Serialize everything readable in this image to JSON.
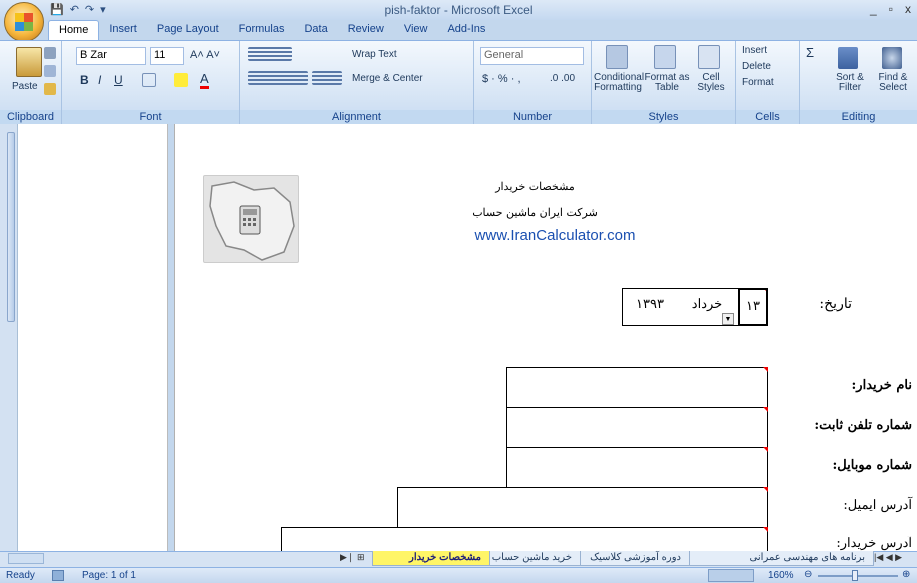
{
  "window": {
    "title": "pish-faktor - Microsoft Excel",
    "controls": [
      "_",
      "▫",
      "x"
    ]
  },
  "quick_access": {
    "save": "💾",
    "undo": "↶",
    "redo": "↷",
    "customize": "▾"
  },
  "ribbon_tabs": [
    "Home",
    "Insert",
    "Page Layout",
    "Formulas",
    "Data",
    "Review",
    "View",
    "Add-Ins"
  ],
  "ribbon": {
    "clipboard": {
      "label": "Clipboard",
      "paste": "Paste"
    },
    "font": {
      "label": "Font",
      "name": "B Zar",
      "size": "11"
    },
    "alignment": {
      "label": "Alignment",
      "wrap": "Wrap Text",
      "merge": "Merge & Center"
    },
    "number": {
      "label": "Number",
      "format": "General"
    },
    "styles": {
      "label": "Styles",
      "conditional": "Conditional Formatting",
      "format_table": "Format as Table",
      "cell_styles": "Cell Styles"
    },
    "cells": {
      "label": "Cells",
      "insert": "Insert",
      "delete": "Delete",
      "format": "Format"
    },
    "editing": {
      "label": "Editing",
      "sort": "Sort & Filter",
      "find": "Find & Select"
    }
  },
  "document": {
    "logo_text": "IRAN CALCULATOR",
    "buyer_header": "مشخصات خريدار",
    "company": "شرکت ایران ماشین حساب",
    "website": "www.IranCalculator.com",
    "date_label": "تاریخ:",
    "date_day": "۱۳",
    "date_month": "خرداد",
    "date_year": "۱۳۹۳",
    "fields": [
      "نام خريدار:",
      "شماره تلفن ثابت:",
      "شماره موبايل:",
      "آدرس ايميل:",
      "آدرس خريدار:"
    ]
  },
  "sheet_tabs": [
    "برنامه های مهندسی عمرانی",
    "دوره آموزشی کلاسیک",
    "خرید ماشین حساب",
    "مشخصات خریدار"
  ],
  "active_sheet": "مشخصات خریدار",
  "status": {
    "ready": "Ready",
    "page": "Page: 1 of 1",
    "zoom": "160%"
  }
}
